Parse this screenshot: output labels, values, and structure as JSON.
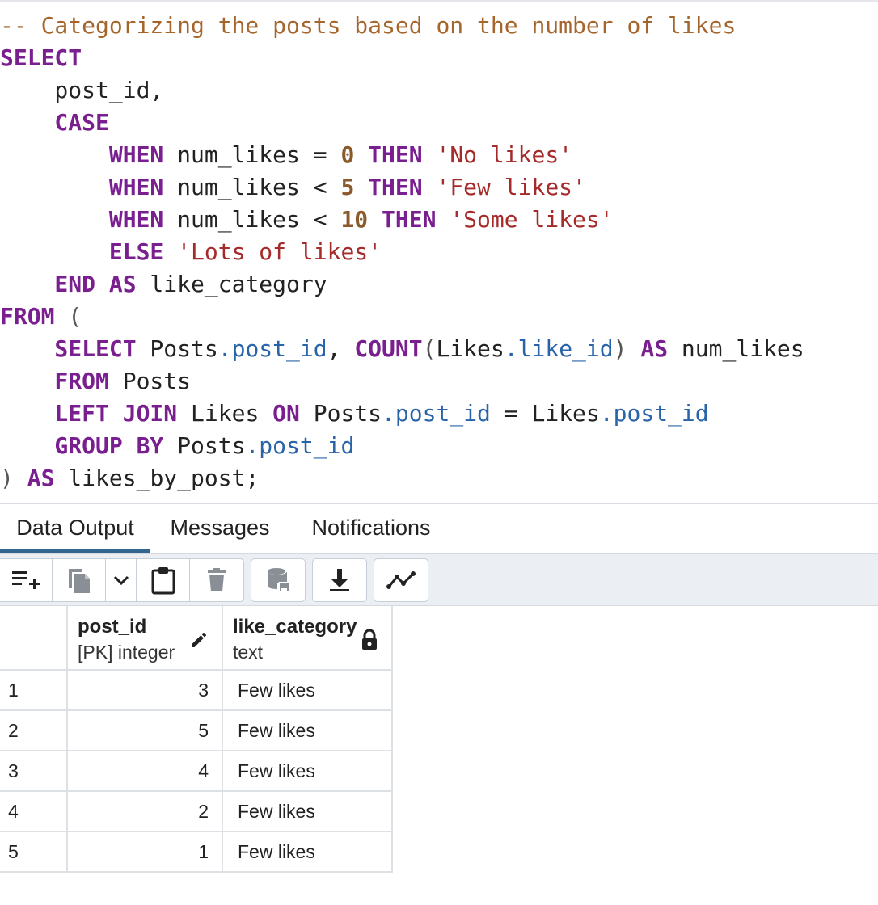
{
  "editor": {
    "lines": [
      [
        {
          "t": "cm",
          "v": "-- Categorizing the posts based on the number of likes"
        }
      ],
      [
        {
          "t": "kw",
          "v": "SELECT"
        }
      ],
      [
        {
          "t": "id",
          "v": "    post_id,"
        }
      ],
      [
        {
          "t": "kw",
          "v": "    CASE"
        }
      ],
      [
        {
          "t": "kw",
          "v": "        WHEN"
        },
        {
          "t": "id",
          "v": " num_likes = "
        },
        {
          "t": "num",
          "v": "0"
        },
        {
          "t": "kw",
          "v": " THEN"
        },
        {
          "t": "str",
          "v": " 'No likes'"
        }
      ],
      [
        {
          "t": "kw",
          "v": "        WHEN"
        },
        {
          "t": "id",
          "v": " num_likes < "
        },
        {
          "t": "num",
          "v": "5"
        },
        {
          "t": "kw",
          "v": " THEN"
        },
        {
          "t": "str",
          "v": " 'Few likes'"
        }
      ],
      [
        {
          "t": "kw",
          "v": "        WHEN"
        },
        {
          "t": "id",
          "v": " num_likes < "
        },
        {
          "t": "num",
          "v": "10"
        },
        {
          "t": "kw",
          "v": " THEN"
        },
        {
          "t": "str",
          "v": " 'Some likes'"
        }
      ],
      [
        {
          "t": "kw",
          "v": "        ELSE"
        },
        {
          "t": "str",
          "v": " 'Lots of likes'"
        }
      ],
      [
        {
          "t": "kw",
          "v": "    END AS"
        },
        {
          "t": "id",
          "v": " like_category"
        }
      ],
      [
        {
          "t": "kw",
          "v": "FROM"
        },
        {
          "t": "pun",
          "v": " ("
        }
      ],
      [
        {
          "t": "kw",
          "v": "    SELECT"
        },
        {
          "t": "id",
          "v": " Posts"
        },
        {
          "t": "prop",
          "v": ".post_id"
        },
        {
          "t": "id",
          "v": ", "
        },
        {
          "t": "kw",
          "v": "COUNT"
        },
        {
          "t": "pun",
          "v": "("
        },
        {
          "t": "id",
          "v": "Likes"
        },
        {
          "t": "prop",
          "v": ".like_id"
        },
        {
          "t": "pun",
          "v": ")"
        },
        {
          "t": "kw",
          "v": " AS"
        },
        {
          "t": "id",
          "v": " num_likes"
        }
      ],
      [
        {
          "t": "kw",
          "v": "    FROM"
        },
        {
          "t": "id",
          "v": " Posts"
        }
      ],
      [
        {
          "t": "kw",
          "v": "    LEFT JOIN"
        },
        {
          "t": "id",
          "v": " Likes "
        },
        {
          "t": "kw",
          "v": "ON"
        },
        {
          "t": "id",
          "v": " Posts"
        },
        {
          "t": "prop",
          "v": ".post_id"
        },
        {
          "t": "id",
          "v": " = Likes"
        },
        {
          "t": "prop",
          "v": ".post_id"
        }
      ],
      [
        {
          "t": "kw",
          "v": "    GROUP BY"
        },
        {
          "t": "id",
          "v": " Posts"
        },
        {
          "t": "prop",
          "v": ".post_id"
        }
      ],
      [
        {
          "t": "pun",
          "v": ")"
        },
        {
          "t": "kw",
          "v": " AS"
        },
        {
          "t": "id",
          "v": " likes_by_post;"
        }
      ]
    ]
  },
  "tabs": [
    {
      "label": "Data Output",
      "active": true
    },
    {
      "label": "Messages",
      "active": false
    },
    {
      "label": "Notifications",
      "active": false
    }
  ],
  "toolbar": {
    "icons": [
      "add-row-icon",
      "copy-icon",
      "chevron-down-icon",
      "paste-icon",
      "delete-icon",
      "save-data-icon",
      "download-icon",
      "graph-icon"
    ]
  },
  "grid": {
    "columns": [
      {
        "name": "post_id",
        "type": "[PK] integer",
        "icon": "edit-icon"
      },
      {
        "name": "like_category",
        "type": "text",
        "icon": "lock-icon"
      }
    ],
    "rows": [
      {
        "num": "1",
        "post_id": "3",
        "like_category": "Few likes"
      },
      {
        "num": "2",
        "post_id": "5",
        "like_category": "Few likes"
      },
      {
        "num": "3",
        "post_id": "4",
        "like_category": "Few likes"
      },
      {
        "num": "4",
        "post_id": "2",
        "like_category": "Few likes"
      },
      {
        "num": "5",
        "post_id": "1",
        "like_category": "Few likes"
      }
    ]
  },
  "colors": {
    "keyword": "#7a1f8f",
    "comment": "#a5652b",
    "string": "#a52a2a",
    "property": "#2a64a8",
    "active_tab": "#326690"
  }
}
